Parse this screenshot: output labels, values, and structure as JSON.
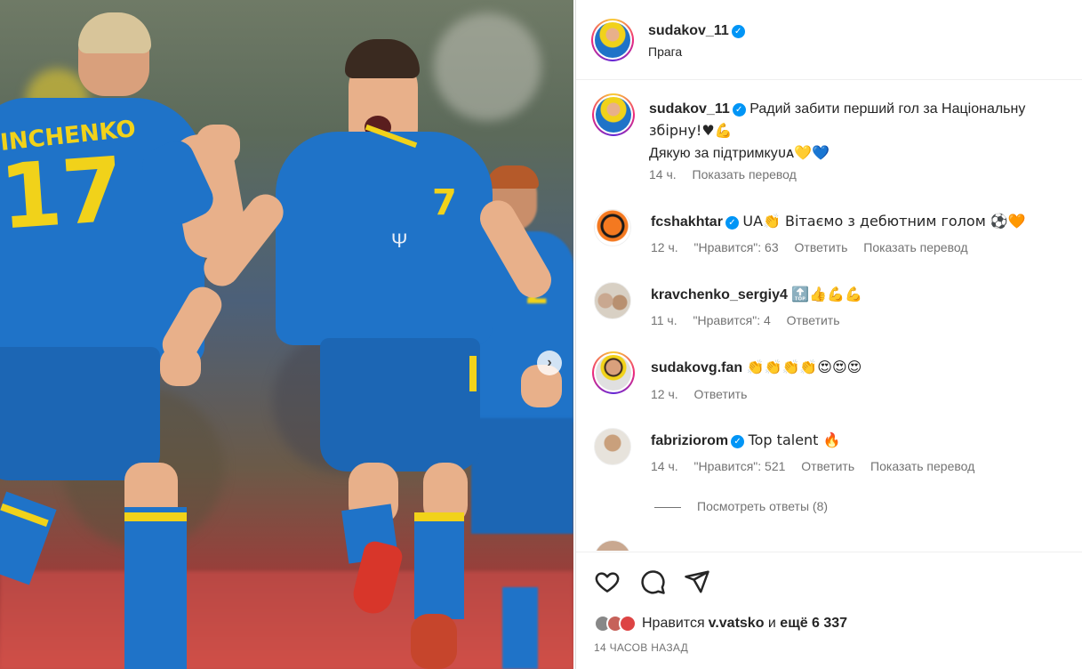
{
  "post": {
    "author": "sudakov_11",
    "location": "Прага",
    "caption_line1": "Радий забити перший гол за Національну",
    "caption_line2": "збірну!♥💪",
    "caption_line3": "Дякую за підтримку",
    "caption_time": "14 ч.",
    "caption_translate": "Показать перевод",
    "jersey_left_number": "17",
    "jersey_center_number": "7",
    "jersey_left_name": "INCHENKO"
  },
  "comments": [
    {
      "user": "fcshakhtar",
      "verified": true,
      "text": "UA👏 Вітаємо з дебютним голом ⚽🧡",
      "time": "12 ч.",
      "likes": "\"Нравится\": 63",
      "reply": "Ответить",
      "translate": "Показать перевод"
    },
    {
      "user": "kravchenko_sergiy4",
      "verified": false,
      "text": "🔝👍💪💪",
      "time": "11 ч.",
      "likes": "\"Нравится\": 4",
      "reply": "Ответить"
    },
    {
      "user": "sudakovg.fan",
      "verified": false,
      "text": "👏👏👏👏😍😍😍",
      "time": "12 ч.",
      "reply": "Ответить"
    },
    {
      "user": "fabriziorom",
      "verified": true,
      "text": "Top talent 🔥",
      "time": "14 ч.",
      "likes": "\"Нравится\": 521",
      "reply": "Ответить",
      "translate": "Показать перевод"
    }
  ],
  "view_replies": "Посмотреть ответы (8)",
  "partial_comment": "",
  "likes": {
    "prefix": "Нравится ",
    "user": "v.vatsko",
    "middle": " и ",
    "more": "ещё 6 337"
  },
  "posted_ago": "14 ЧАСОВ НАЗАД",
  "icons": {
    "like": "heart-icon",
    "comment": "comment-icon",
    "share": "share-icon",
    "next": "chevron-right-icon",
    "verified": "verified-badge-icon"
  },
  "colors": {
    "verified": "#0095f6",
    "muted": "#737373",
    "text": "#262626",
    "ukraine_blue": "#1f73c8",
    "ukraine_yellow": "#f1d21a"
  }
}
